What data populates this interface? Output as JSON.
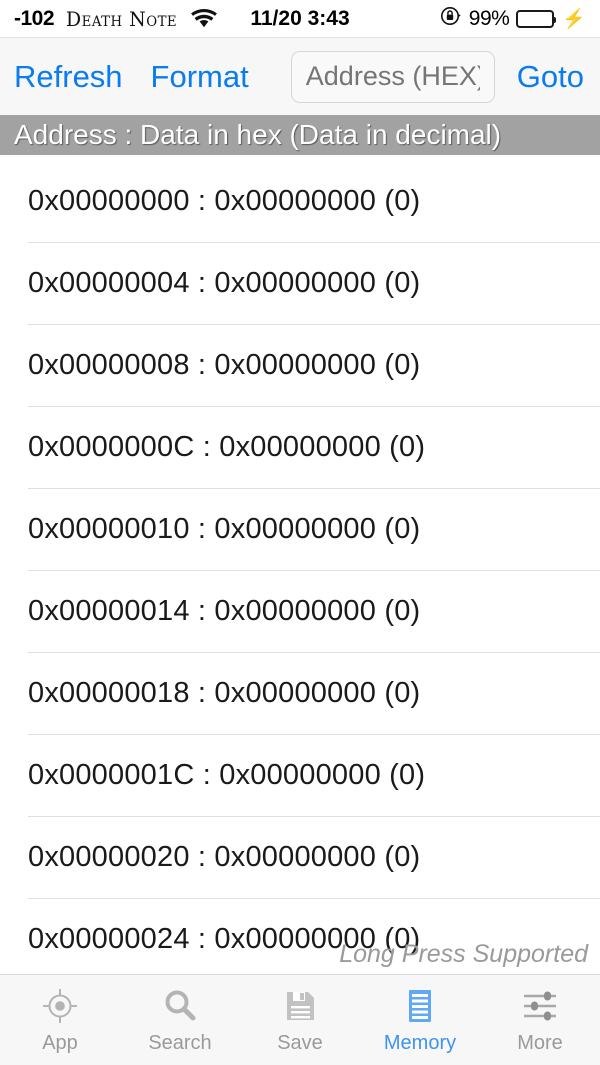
{
  "status_bar": {
    "signal": "-102",
    "carrier": "Death Note",
    "wifi_icon": "wifi-icon",
    "time": "11/20 3:43",
    "rotation_lock_icon": "rotation-lock-icon",
    "battery_percent": "99%",
    "battery_level": 99,
    "charging_icon": "lightning-bolt-icon"
  },
  "toolbar": {
    "refresh_label": "Refresh",
    "format_label": "Format",
    "address_placeholder": "Address (HEX)",
    "address_value": "",
    "goto_label": "Goto"
  },
  "section": {
    "header": "Address : Data in hex (Data in decimal)"
  },
  "memory": {
    "hint": "Long Press Supported",
    "rows": [
      {
        "text": "0x00000000 : 0x00000000 (0)"
      },
      {
        "text": "0x00000004 : 0x00000000 (0)"
      },
      {
        "text": "0x00000008 : 0x00000000 (0)"
      },
      {
        "text": "0x0000000C : 0x00000000 (0)"
      },
      {
        "text": "0x00000010 : 0x00000000 (0)"
      },
      {
        "text": "0x00000014 : 0x00000000 (0)"
      },
      {
        "text": "0x00000018 : 0x00000000 (0)"
      },
      {
        "text": "0x0000001C : 0x00000000 (0)"
      },
      {
        "text": "0x00000020 : 0x00000000 (0)"
      },
      {
        "text": "0x00000024 : 0x00000000 (0)"
      }
    ]
  },
  "tab_bar": {
    "active": "Memory",
    "tabs": [
      {
        "label": "App",
        "icon": "target-crosshair-icon"
      },
      {
        "label": "Search",
        "icon": "magnifier-icon"
      },
      {
        "label": "Save",
        "icon": "floppy-disk-icon"
      },
      {
        "label": "Memory",
        "icon": "document-lines-icon"
      },
      {
        "label": "More",
        "icon": "sliders-icon"
      }
    ]
  },
  "colors": {
    "accent_blue": "#0a7cf0",
    "tab_active_blue": "#3f93f0",
    "header_gray": "#a2a2a2",
    "battery_green": "#4cd763",
    "inactive_gray": "#9a9a9a"
  }
}
